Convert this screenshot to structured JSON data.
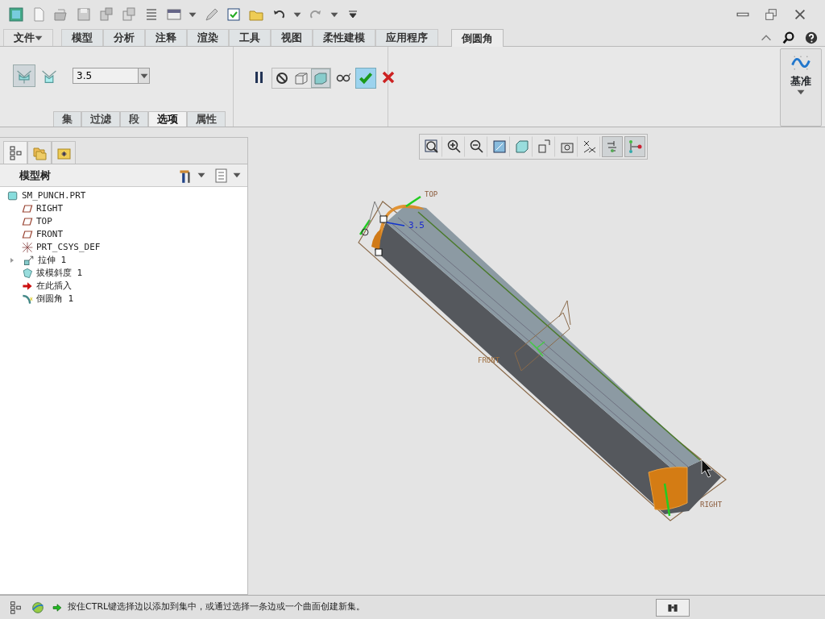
{
  "ribbon_tabs": [
    {
      "label": "文件",
      "kind": "menu",
      "selected": false
    },
    {
      "label": "模型",
      "kind": "tab",
      "selected": false
    },
    {
      "label": "分析",
      "kind": "tab",
      "selected": false
    },
    {
      "label": "注释",
      "kind": "tab",
      "selected": false
    },
    {
      "label": "渲染",
      "kind": "tab",
      "selected": false
    },
    {
      "label": "工具",
      "kind": "tab",
      "selected": false
    },
    {
      "label": "视图",
      "kind": "tab",
      "selected": false
    },
    {
      "label": "柔性建模",
      "kind": "tab",
      "selected": false
    },
    {
      "label": "应用程序",
      "kind": "tab",
      "selected": false
    },
    {
      "label": "倒圆角",
      "kind": "tab",
      "selected": true
    }
  ],
  "fillet_types": [
    {
      "selected": true
    },
    {
      "selected": false
    }
  ],
  "radius_field": {
    "value": "3.5"
  },
  "sub_tabs": [
    {
      "label": "集",
      "selected": false
    },
    {
      "label": "过滤",
      "selected": false
    },
    {
      "label": "段",
      "selected": false
    },
    {
      "label": "选项",
      "selected": true
    },
    {
      "label": "属性",
      "selected": false
    }
  ],
  "preview_modes": [
    {
      "selected": false
    },
    {
      "selected": false
    },
    {
      "selected": true
    }
  ],
  "datum_button": {
    "label": "基准"
  },
  "panel_tabs": [
    {
      "selected": true
    },
    {
      "selected": false
    },
    {
      "selected": false
    }
  ],
  "model_tree": {
    "title": "模型树",
    "items": [
      {
        "label": "SM_PUNCH.PRT",
        "children": [
          {
            "label": "RIGHT"
          },
          {
            "label": "TOP"
          },
          {
            "label": "FRONT"
          },
          {
            "label": "PRT_CSYS_DEF"
          },
          {
            "label": "拉伸 1",
            "expanded": false
          },
          {
            "label": "拔模斜度 1"
          },
          {
            "label": "在此插入"
          },
          {
            "label": "倒圆角 1"
          }
        ]
      }
    ]
  },
  "view_tools": [
    {
      "pressed": false
    },
    {
      "pressed": false
    },
    {
      "pressed": false
    },
    {
      "pressed": false
    },
    {
      "pressed": false
    },
    {
      "pressed": false
    },
    {
      "pressed": false
    },
    {
      "pressed": false
    },
    {
      "pressed": true
    },
    {
      "pressed": true
    }
  ],
  "viewport": {
    "labels": [
      {
        "kind": "datum",
        "text": "TOP"
      },
      {
        "kind": "dimension",
        "text": "3.5"
      },
      {
        "kind": "datum",
        "text": "FRONT"
      },
      {
        "kind": "datum",
        "text": "RIGHT"
      }
    ]
  },
  "status_bar": {
    "message": "按住CTRL键选择边以添加到集中，或通过选择一条边或一个曲面创建新集。"
  }
}
